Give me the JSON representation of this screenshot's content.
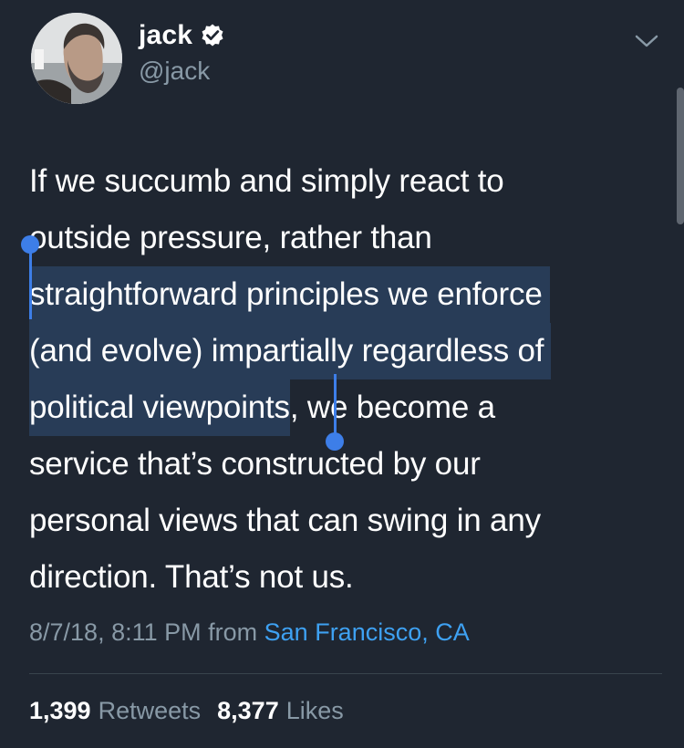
{
  "author": {
    "display_name": "jack",
    "handle": "@jack",
    "verified": true
  },
  "tweet": {
    "lines": [
      {
        "text": "If we succumb and simply react to"
      },
      {
        "text": "outside pressure, rather than"
      },
      {
        "text": "straightforward principles we enforce"
      },
      {
        "text": "(and evolve) impartially regardless of"
      },
      {
        "selected": "political viewpoints",
        "rest": ", we become a"
      },
      {
        "text": "service that’s constructed by our"
      },
      {
        "text": "personal views that can swing in any"
      },
      {
        "text": "direction. That’s not us."
      }
    ]
  },
  "meta": {
    "timestamp": "8/7/18, 8:11 PM",
    "from_label": "from",
    "source": "San Francisco, CA"
  },
  "stats": {
    "retweets_count": "1,399",
    "retweets_label": "Retweets",
    "likes_count": "8,377",
    "likes_label": "Likes"
  },
  "colors": {
    "background": "#1f2631",
    "secondary_text": "#8899a6",
    "link": "#3ea1f2",
    "selection_handle": "#3d7ee8",
    "selection_highlight": "#2f4e76"
  },
  "icons": {
    "verified": "verified-badge-icon",
    "more": "chevron-down-icon"
  }
}
